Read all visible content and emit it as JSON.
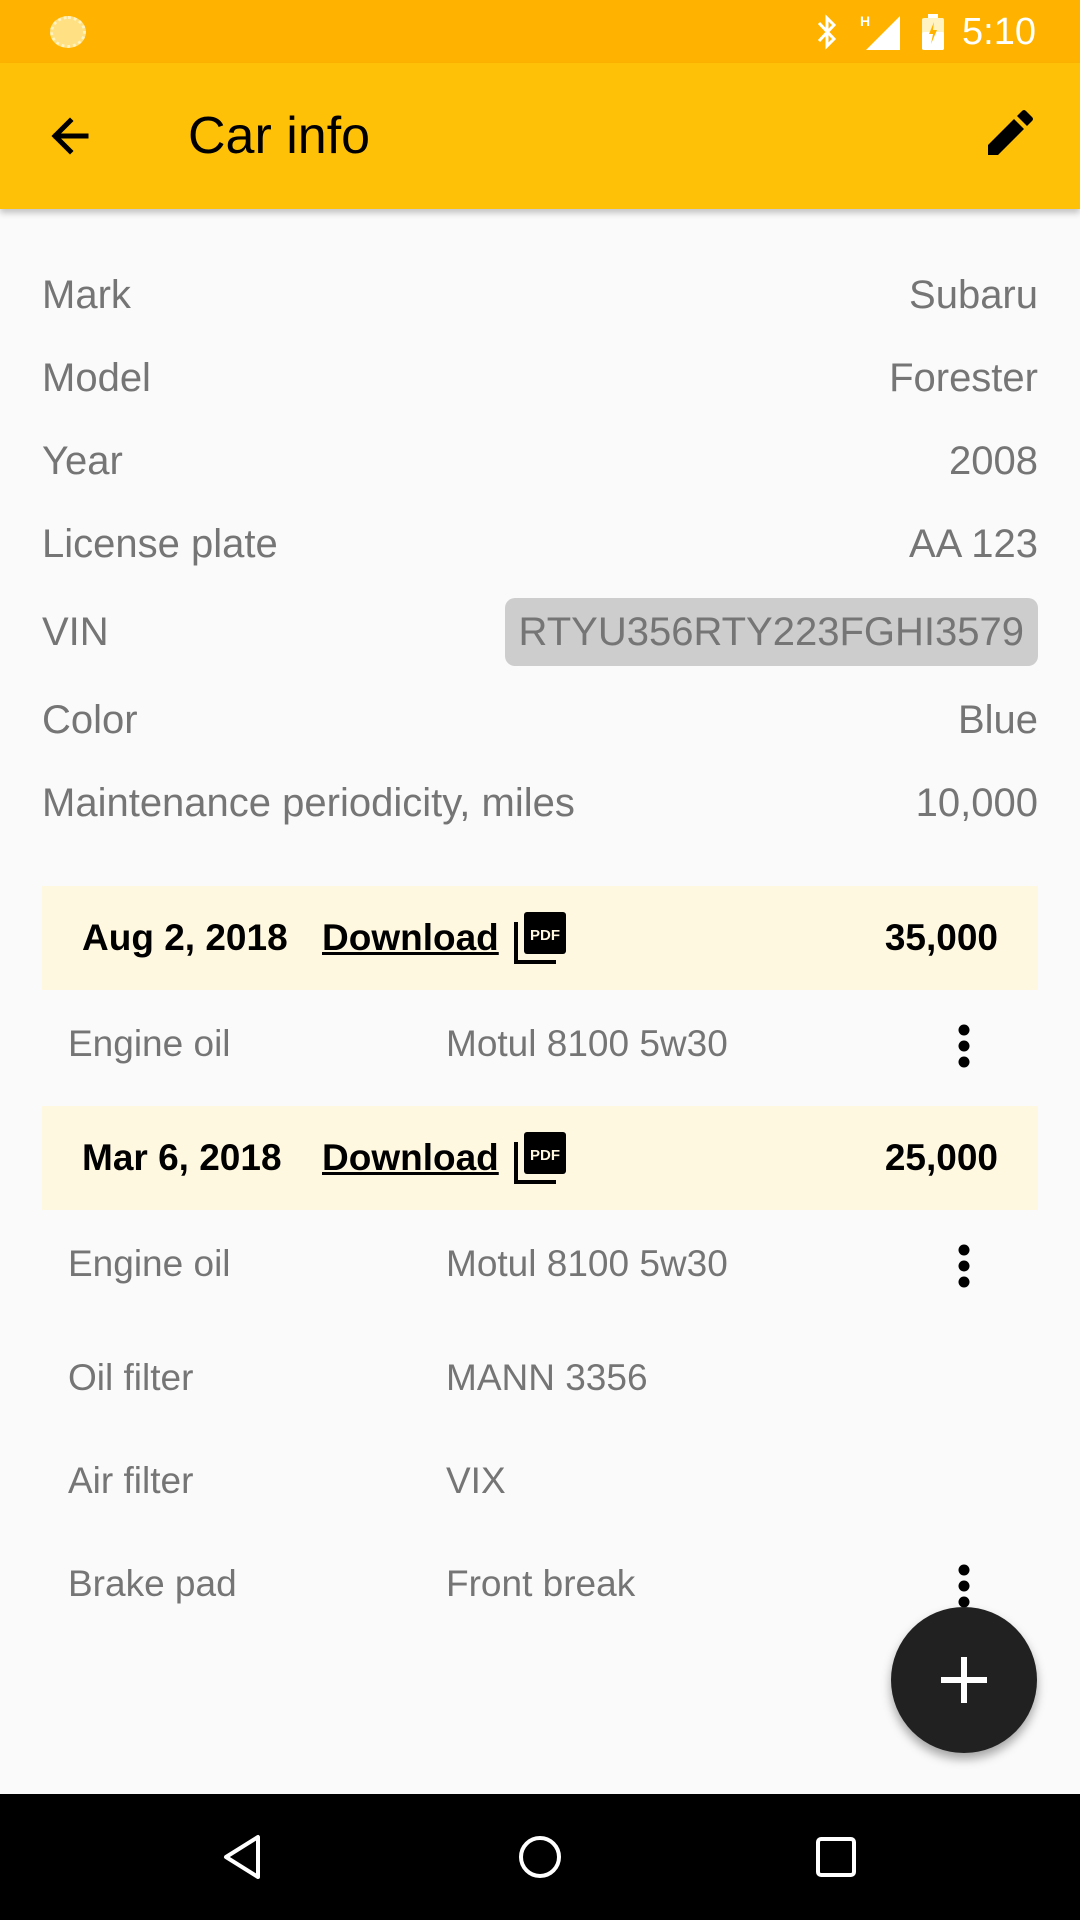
{
  "status_bar": {
    "time": "5:10",
    "network_label": "H"
  },
  "app_bar": {
    "title": "Car info"
  },
  "car_info": [
    {
      "label": "Mark",
      "value": "Subaru"
    },
    {
      "label": "Model",
      "value": "Forester"
    },
    {
      "label": "Year",
      "value": "2008"
    },
    {
      "label": "License plate",
      "value": "AA 123"
    },
    {
      "label": "VIN",
      "value": "RTYU356RTY223FGHI3579"
    },
    {
      "label": "Color",
      "value": "Blue"
    },
    {
      "label": "Maintenance periodicity, miles",
      "value": "10,000"
    }
  ],
  "records": [
    {
      "date": "Aug 2, 2018",
      "download_label": "Download",
      "pdf_badge": "PDF",
      "mileage": "35,000",
      "items": [
        {
          "name": "Engine oil",
          "value": "Motul 8100 5w30"
        }
      ]
    },
    {
      "date": "Mar 6, 2018",
      "download_label": "Download",
      "pdf_badge": "PDF",
      "mileage": "25,000",
      "items": [
        {
          "name": "Engine oil",
          "value": "Motul 8100 5w30"
        },
        {
          "name": "Oil filter",
          "value": "MANN 3356"
        },
        {
          "name": "Air filter",
          "value": "VIX"
        },
        {
          "name": "Brake pad",
          "value": "Front break"
        }
      ]
    }
  ],
  "colors": {
    "status_bar": "#ffb300",
    "app_bar": "#ffc107",
    "record_header_bg": "#fff8e1",
    "vin_highlight": "#cdcdcd",
    "fab": "#212121"
  },
  "icons": [
    "sun-icon",
    "bluetooth-icon",
    "signal-icon",
    "battery-icon",
    "back-arrow-icon",
    "edit-pencil-icon",
    "pdf-icon",
    "more-vert-icon",
    "add-icon",
    "nav-back-icon",
    "nav-home-icon",
    "nav-recents-icon"
  ]
}
